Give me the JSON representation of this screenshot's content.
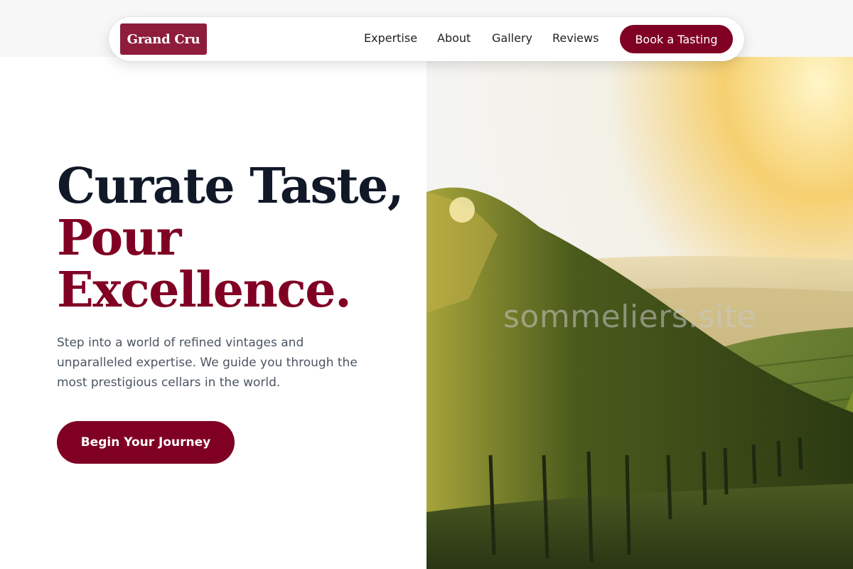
{
  "navbar": {
    "logo": "Grand Cru",
    "links": [
      {
        "label": "Expertise"
      },
      {
        "label": "About"
      },
      {
        "label": "Gallery"
      },
      {
        "label": "Reviews"
      }
    ],
    "cta_label": "Book a Tasting"
  },
  "hero": {
    "headline_line1": "Curate Taste,",
    "headline_line2": "Pour",
    "headline_line3": "Excellence.",
    "subtext": "Step into a world of refined vintages and unparalleled expertise. We guide you through the most prestigious cellars in the world.",
    "cta_label": "Begin Your Journey",
    "image_watermark": "sommeliers.site"
  },
  "colors": {
    "brand": "#800024",
    "logo_bg": "#8e1d3c",
    "heading_dark": "#111827",
    "body_text": "#4b5563"
  }
}
